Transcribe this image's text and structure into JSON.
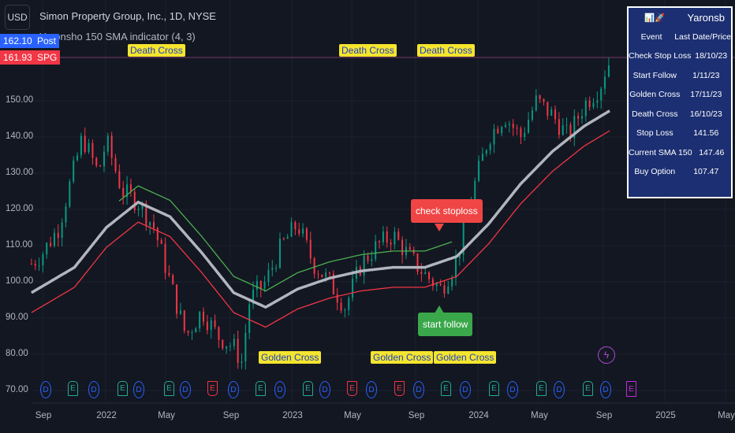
{
  "header": {
    "currency": "USD",
    "title": "Simon Property Group, Inc., 1D, NYSE",
    "indicator": "Yaronsho 150 SMA indicator (4, 3)"
  },
  "price_labels": {
    "post_price": "162.10",
    "post_tag": "Post",
    "last_price": "161.93",
    "ticker": "SPG"
  },
  "colors": {
    "bg": "#131722",
    "up": "#089981",
    "down": "#f23645",
    "sma": "#b2b5be",
    "upper": "#4caf50",
    "lower": "#f23645",
    "table": "#1c2f72"
  },
  "table": {
    "icon": "chart-rocket",
    "name": "Yaronsb",
    "col1": "Event",
    "col2": "Last Date/Price",
    "rows": [
      [
        "Check Stop Loss",
        "18/10/23"
      ],
      [
        "Start Follow",
        "1/11/23"
      ],
      [
        "Golden Cross",
        "17/11/23"
      ],
      [
        "Death Cross",
        "16/10/23"
      ],
      [
        "Stop Loss",
        "141.56"
      ],
      [
        "Current SMA 150",
        "147.46"
      ],
      [
        "Buy Option",
        "107.47"
      ]
    ]
  },
  "annotations": {
    "death_cross": "Death Cross",
    "golden_cross": "Golden Cross",
    "check_stoploss": "check stoploss",
    "start_follow": "start follow"
  },
  "y_axis": [
    "150.00",
    "140.00",
    "130.00",
    "120.00",
    "110.00",
    "100.00",
    "90.00",
    "80.00",
    "70.00"
  ],
  "x_axis": [
    "Sep",
    "2022",
    "May",
    "Sep",
    "2023",
    "May",
    "Sep",
    "2024",
    "May",
    "Sep",
    "2025",
    "May"
  ],
  "events": [
    "D",
    "E",
    "D",
    "E",
    "D",
    "E",
    "D",
    "E",
    "D",
    "E",
    "D",
    "E",
    "D",
    "E",
    "D",
    "E",
    "D",
    "E",
    "D",
    "E",
    "D",
    "E",
    "D",
    "E",
    "D",
    "E"
  ],
  "event_types": [
    "div",
    "earn-up",
    "div",
    "earn-up",
    "div",
    "earn-up",
    "div",
    "earn-down",
    "div",
    "earn-up",
    "div",
    "earn-up",
    "div",
    "earn-down",
    "div",
    "earn-down",
    "div",
    "earn-up",
    "div",
    "earn-up",
    "div",
    "earn-up",
    "div",
    "earn-up",
    "div",
    "earn-future"
  ],
  "chart_data": {
    "type": "candlestick",
    "price": [
      [
        -0.7,
        105
      ],
      [
        0,
        108
      ],
      [
        1,
        115
      ],
      [
        2.5,
        140
      ],
      [
        3.5,
        130
      ],
      [
        4,
        139
      ],
      [
        5,
        125
      ],
      [
        6,
        122
      ],
      [
        7,
        115
      ],
      [
        8,
        100
      ],
      [
        9,
        85
      ],
      [
        10,
        92
      ],
      [
        11,
        85
      ],
      [
        12,
        82
      ],
      [
        12.5,
        78
      ],
      [
        13,
        95
      ],
      [
        14,
        100
      ],
      [
        15,
        110
      ],
      [
        16,
        116
      ],
      [
        17,
        105
      ],
      [
        18,
        100
      ],
      [
        19,
        93
      ],
      [
        20,
        105
      ],
      [
        21,
        110
      ],
      [
        22,
        113
      ],
      [
        23,
        107
      ],
      [
        24,
        102
      ],
      [
        25,
        98
      ],
      [
        26,
        106
      ],
      [
        27,
        125
      ],
      [
        28,
        140
      ],
      [
        29,
        146
      ],
      [
        30,
        140
      ],
      [
        31,
        150
      ],
      [
        32,
        146
      ],
      [
        33,
        140
      ],
      [
        34,
        149
      ],
      [
        35,
        154
      ],
      [
        35.5,
        161
      ],
      [
        35.7,
        158
      ]
    ],
    "sma150": [
      [
        -0.7,
        97
      ],
      [
        2,
        104
      ],
      [
        4,
        115
      ],
      [
        6,
        122
      ],
      [
        8,
        118
      ],
      [
        10,
        108
      ],
      [
        12,
        97
      ],
      [
        14,
        93
      ],
      [
        16,
        98
      ],
      [
        18,
        101
      ],
      [
        20,
        103
      ],
      [
        22,
        104
      ],
      [
        24,
        104
      ],
      [
        26,
        107
      ],
      [
        28,
        116
      ],
      [
        30,
        127
      ],
      [
        32,
        136
      ],
      [
        34,
        143
      ],
      [
        35.7,
        147.5
      ]
    ],
    "ylim": [
      68,
      165
    ]
  }
}
